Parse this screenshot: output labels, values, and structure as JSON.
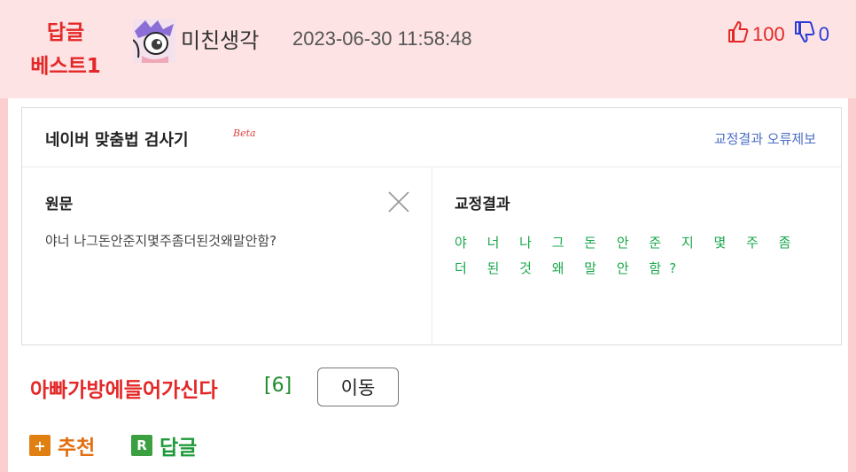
{
  "header": {
    "badge_line1": "답글",
    "badge_line2": "베스트1",
    "nickname": "미친생각",
    "datetime": "2023-06-30 11:58:48",
    "upvotes": "100",
    "downvotes": "0"
  },
  "checker": {
    "title": "네이버 맞춤법 검사기",
    "beta": "Beta",
    "report_link": "교정결과 오류제보",
    "original_label": "원문",
    "original_text": "야너 나그돈안준지몇주좀더된것왜말안함?",
    "result_label": "교정결과",
    "result_text": "야 너 나 그 돈 안 준 지 몇 주 좀 더 된 것 왜 말 안 함?"
  },
  "post": {
    "title": "아빠가방에들어가신다",
    "comment_count": "[6]",
    "move_button": "이동"
  },
  "actions": {
    "recommend_icon_glyph": "+",
    "recommend": "추천",
    "reply_icon_glyph": "R",
    "reply": "답글"
  },
  "colors": {
    "accent_red": "#e42727",
    "header_bg": "#fde3e3",
    "correction_green": "#19a84b",
    "link_blue": "#4a6cc4"
  }
}
